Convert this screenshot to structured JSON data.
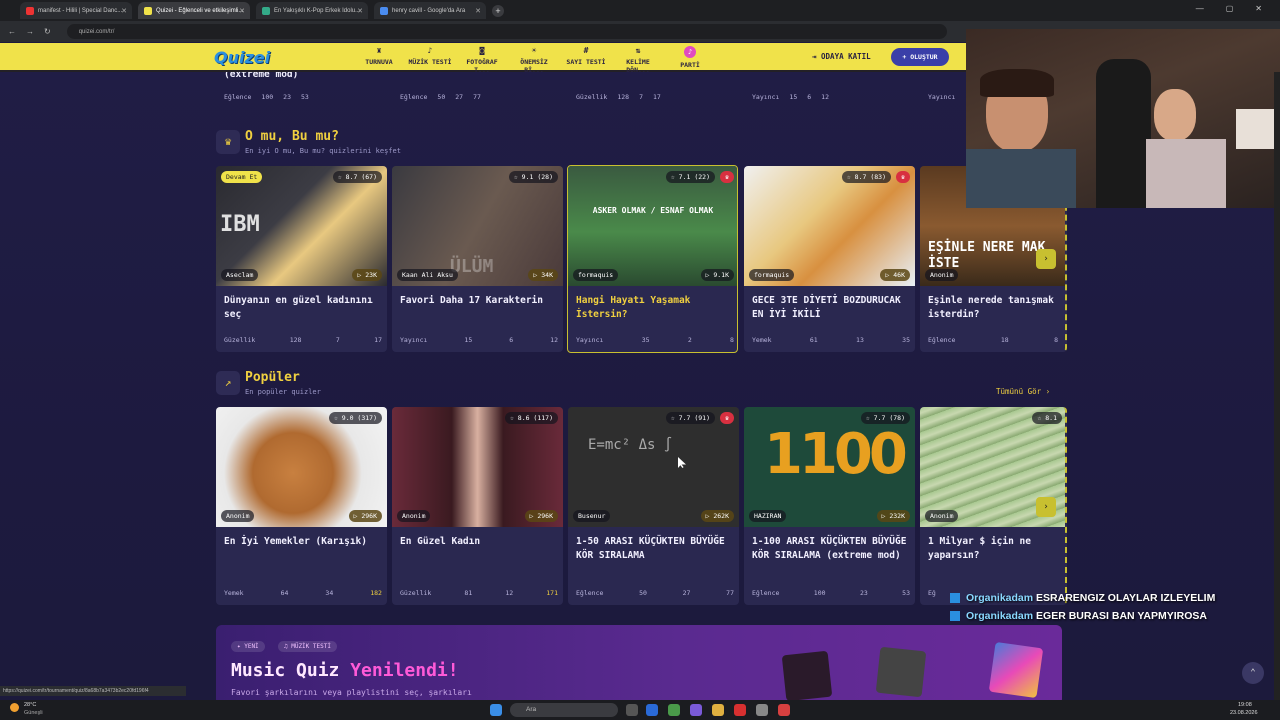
{
  "browser": {
    "tabs": [
      {
        "title": "manifest - Hilili | Special Danc...",
        "active": false
      },
      {
        "title": "Quizei - Eğlenceli ve etkileşimli...",
        "active": true
      },
      {
        "title": "En Yakışıklı K-Pop Erkek Idolu...",
        "active": false
      },
      {
        "title": "henry cavill - Google'da Ara",
        "active": false
      }
    ],
    "url": "quizei.com/tr/",
    "status_url": "https://quizei.com/tr/tournament/quiz/8a68b7a3473b2ec20fd196f4"
  },
  "nav": {
    "logo": "Quizei",
    "items": [
      {
        "label": "TURNUVA",
        "icon": "trophy-icon"
      },
      {
        "label": "MÜZİK TESTİ",
        "icon": "music-icon"
      },
      {
        "label": "FOTOĞRAF T...",
        "icon": "camera-icon"
      },
      {
        "label": "ÖNEMSİZ Bİ...",
        "icon": "bulb-icon"
      },
      {
        "label": "SAYI TESTİ",
        "icon": "hash-icon"
      },
      {
        "label": "KELİME DÖN...",
        "icon": "swap-icon"
      },
      {
        "label": "PARTİ",
        "icon": "party-icon"
      }
    ],
    "join": "ODAYA KATIL",
    "create": "+ OLUŞTUR"
  },
  "top_partial": {
    "title_tail": "(extreme mod)",
    "rows": [
      {
        "category": "Eğlence",
        "q": "100",
        "c": "23",
        "l": "53"
      },
      {
        "category": "Eğlence",
        "q": "50",
        "c": "27",
        "l": "77"
      },
      {
        "category": "Güzellik",
        "q": "128",
        "c": "7",
        "l": "17"
      },
      {
        "category": "Yayıncı",
        "q": "15",
        "c": "6",
        "l": "12"
      },
      {
        "category": "Yayıncı",
        "q": "",
        "c": "",
        "l": ""
      }
    ]
  },
  "section1": {
    "title": "O mu, Bu mu?",
    "subtitle": "En iyi O mu, Bu mu? quizlerini keşfet",
    "cards": [
      {
        "badge": "Devam Et",
        "rating": "☆ 8.7 (67)",
        "author": "Aseclam",
        "plays": "▷ 23K",
        "title": "Dünyanın en güzel kadınını seç",
        "category": "Güzellik",
        "q": "128",
        "c": "7",
        "l": "17",
        "thumb_text": "IBM"
      },
      {
        "badge": "",
        "rating": "☆ 9.1 (28)",
        "author": "Kaan Ali Aksu",
        "plays": "▷ 34K",
        "title": "Favori Daha 17 Karakterin",
        "category": "Yayıncı",
        "q": "15",
        "c": "6",
        "l": "12",
        "thumb_text": "ÜLÜM"
      },
      {
        "badge": "",
        "rating": "☆ 7.1 (22)",
        "author": "formaquis",
        "plays": "▷ 9.1K",
        "title": "Hangi Hayatı Yaşamak İstersin?",
        "category": "Yayıncı",
        "q": "35",
        "c": "2",
        "l": "8",
        "thumb_text": "ASKER OLMAK / ESNAF OLMAK"
      },
      {
        "badge": "",
        "rating": "☆ 8.7 (83)",
        "author": "formaquis",
        "plays": "▷ 46K",
        "title": "GECE 3TE DİYETİ BOZDURUCAK EN İYİ İKİLİ",
        "category": "Yemek",
        "q": "61",
        "c": "13",
        "l": "35",
        "thumb_text": ""
      },
      {
        "badge": "",
        "rating": "",
        "author": "Anonim",
        "plays": "",
        "title": "Eşinle nerede tanışmak isterdin?",
        "category": "Eğlence",
        "q": "18",
        "c": "8",
        "l": "",
        "thumb_text": "EŞİNLE NERE MAK İSTE"
      }
    ]
  },
  "section2": {
    "title": "Popüler",
    "subtitle": "En popüler quizler",
    "see_all": "Tümünü Gör ›",
    "cards": [
      {
        "rating": "☆ 9.0 (317)",
        "author": "Anonim",
        "plays": "▷ 296K",
        "title": "En İyi Yemekler (Karışık)",
        "category": "Yemek",
        "q": "64",
        "c": "34",
        "l": "182",
        "thumb_text": ""
      },
      {
        "rating": "☆ 8.6 (117)",
        "author": "Anonim",
        "plays": "▷ 296K",
        "title": "En Güzel Kadın",
        "category": "Güzellik",
        "q": "81",
        "c": "12",
        "l": "171",
        "thumb_text": ""
      },
      {
        "rating": "☆ 7.7 (91)",
        "author": "Busenur",
        "plays": "▷ 262K",
        "title": "1-50 ARASI KÜÇÜKTEN BÜYÜĞE KÖR SIRALAMA",
        "category": "Eğlence",
        "q": "50",
        "c": "27",
        "l": "77",
        "thumb_text": "E=mc²  Δs  ∫"
      },
      {
        "rating": "☆ 7.7 (78)",
        "author": "HAZIRAN",
        "plays": "▷ 232K",
        "title": "1-100 ARASI KÜÇÜKTEN BÜYÜĞE KÖR SIRALAMA (extreme mod)",
        "category": "Eğlence",
        "q": "100",
        "c": "23",
        "l": "53",
        "thumb_text": "1100"
      },
      {
        "rating": "☆ 8.1",
        "author": "Anonim",
        "plays": "",
        "title": "1 Milyar $ için ne yaparsın?",
        "category": "Eğ",
        "q": "",
        "c": "",
        "l": "",
        "thumb_text": ""
      }
    ]
  },
  "banner": {
    "chip_new": "✦ YENİ",
    "chip_music": "♫ MÜZİK TESTİ",
    "title_a": "Music Quiz ",
    "title_b": "Yenilendi!",
    "subtitle": "Favori şarkılarını veya playlistini seç, şarkıları"
  },
  "chat": [
    {
      "name": "Organikadam",
      "msg": "ESRARENGIZ OLAYLAR IZLEYELIM"
    },
    {
      "name": "Organikadam",
      "msg": "EGER BURASI BAN YAPMYIROSA"
    }
  ],
  "taskbar": {
    "weather_temp": "28°C",
    "weather_text": "Güneşli",
    "search_placeholder": "Ara",
    "time": "19:08",
    "date": "23.08.2026"
  },
  "colors": {
    "accent_yellow": "#f0e24a",
    "brand_blue": "#2a8fe0",
    "bg": "#1c1a3c",
    "card": "#2a2850"
  }
}
